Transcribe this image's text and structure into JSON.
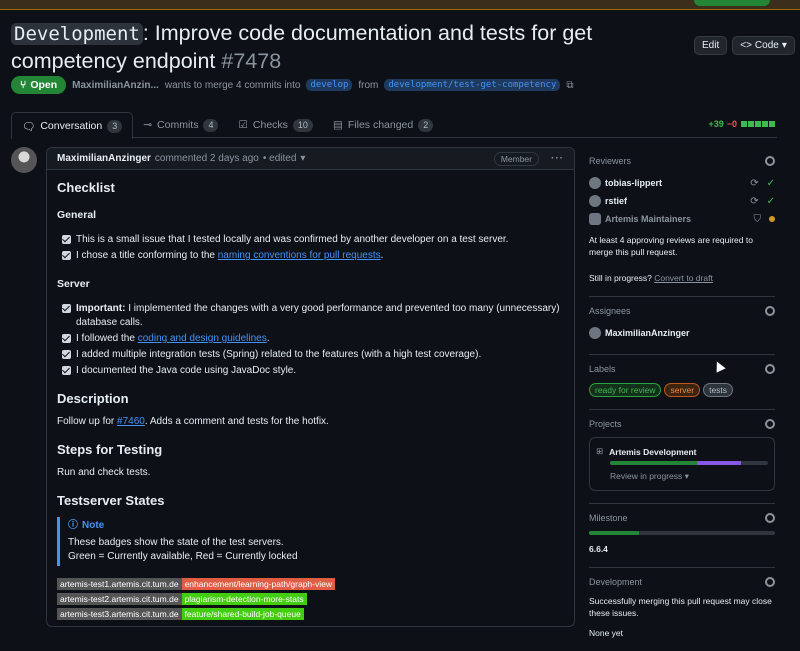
{
  "pr": {
    "branch_label": "Development",
    "title": ": Improve code documentation and tests for get competency endpoint",
    "number": "#7478",
    "edit_label": "Edit",
    "code_label": "Code",
    "state": "Open",
    "author": "MaximilianAnzin...",
    "merge_text": "wants to merge 4 commits into",
    "base": "develop",
    "from_text": "from",
    "head": "development/test-get-competency"
  },
  "tabs": [
    {
      "label": "Conversation",
      "count": "3"
    },
    {
      "label": "Commits",
      "count": "4"
    },
    {
      "label": "Checks",
      "count": "10"
    },
    {
      "label": "Files changed",
      "count": "2"
    }
  ],
  "diffstat": {
    "added": "+39",
    "removed": "−0"
  },
  "comment": {
    "author": "MaximilianAnzinger",
    "action": "commented 2 days ago",
    "edited": "• edited",
    "role": "Member",
    "checklist_title": "Checklist",
    "general_title": "General",
    "general_items": [
      {
        "text": "This is a small issue that I tested locally and was confirmed by another developer on a test server."
      },
      {
        "text": "I chose a title conforming to the ",
        "link": "naming conventions for pull requests",
        "after": "."
      }
    ],
    "server_title": "Server",
    "server_items": [
      {
        "strong": "Important:",
        "text": " I implemented the changes with a very good performance and prevented too many (unnecessary) database calls."
      },
      {
        "text": "I followed the ",
        "link": "coding and design guidelines",
        "after": "."
      },
      {
        "text": "I added multiple integration tests (Spring) related to the features (with a high test coverage)."
      },
      {
        "text": "I documented the Java code using JavaDoc style."
      }
    ],
    "description_title": "Description",
    "description_pre": "Follow up for ",
    "description_link": "#7460",
    "description_post": ". Adds a comment and tests for the hotfix.",
    "steps_title": "Steps for Testing",
    "steps_text": "Run and check tests.",
    "testserver_title": "Testserver States",
    "note_title": "Note",
    "note_line1": "These badges show the state of the test servers.",
    "note_line2": "Green = Currently available, Red = Currently locked",
    "badges": [
      {
        "server": "artemis-test1.artemis.cit.tum.de",
        "branch": "enhancement/learning-path/graph-view",
        "color": "#e05d44"
      },
      {
        "server": "artemis-test2.artemis.cit.tum.de",
        "branch": "plagiarism-detection-more-stats",
        "color": "#4c1"
      },
      {
        "server": "artemis-test3.artemis.cit.tum.de",
        "branch": "feature/shared-build-job-queue",
        "color": "#4c1"
      }
    ]
  },
  "sidebar": {
    "reviewers_title": "Reviewers",
    "reviewers": [
      {
        "name": "tobias-lippert"
      },
      {
        "name": "rstief"
      },
      {
        "name": "Artemis Maintainers"
      }
    ],
    "review_note": "At least 4 approving reviews are required to merge this pull request.",
    "progress_q": "Still in progress?",
    "convert_link": "Convert to draft",
    "assignees_title": "Assignees",
    "assignee": "MaximilianAnzinger",
    "labels_title": "Labels",
    "labels": [
      {
        "name": "ready for review",
        "color": "#3fb950"
      },
      {
        "name": "server",
        "color": "#f0883e"
      },
      {
        "name": "tests",
        "color": "#8b949e"
      }
    ],
    "projects_title": "Projects",
    "project_name": "Artemis Development",
    "project_status": "Review in progress",
    "project_progress": [
      0.55,
      0.28
    ],
    "milestone_title": "Milestone",
    "milestone_name": "6.6.4",
    "milestone_progress": 0.27,
    "development_title": "Development",
    "development_text": "Successfully merging this pull request may close these issues.",
    "development_none": "None yet"
  }
}
